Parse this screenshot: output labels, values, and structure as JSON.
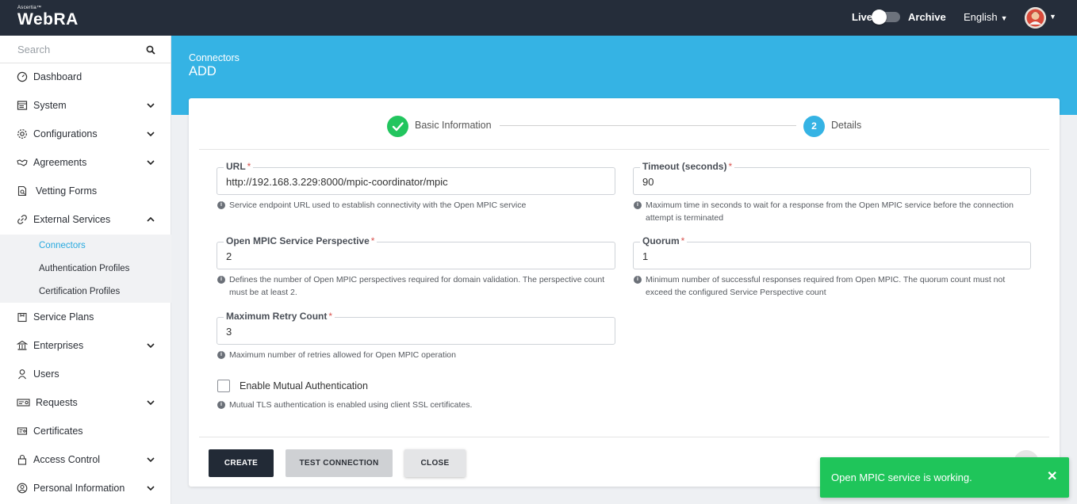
{
  "header": {
    "brand_small": "Ascertia™",
    "brand": "WebRA",
    "live_label": "Live",
    "archive_label": "Archive",
    "language": "English"
  },
  "sidebar": {
    "search_placeholder": "Search",
    "items": [
      {
        "label": "Dashboard",
        "icon": "dashboard-icon"
      },
      {
        "label": "System",
        "icon": "system-icon"
      },
      {
        "label": "Configurations",
        "icon": "gear-icon"
      },
      {
        "label": "Agreements",
        "icon": "handshake-icon"
      },
      {
        "label": "Vetting Forms",
        "icon": "document-search-icon"
      },
      {
        "label": "External Services",
        "icon": "link-icon"
      },
      {
        "label": "Service Plans",
        "icon": "package-icon"
      },
      {
        "label": "Enterprises",
        "icon": "bank-icon"
      },
      {
        "label": "Users",
        "icon": "user-icon"
      },
      {
        "label": "Requests",
        "icon": "requests-icon"
      },
      {
        "label": "Certificates",
        "icon": "certificate-icon"
      },
      {
        "label": "Access Control",
        "icon": "lock-icon"
      },
      {
        "label": "Personal Information",
        "icon": "user-circle-icon"
      }
    ],
    "sub_items": [
      "Connectors",
      "Authentication Profiles",
      "Certification Profiles"
    ]
  },
  "page": {
    "breadcrumb": "Connectors",
    "title": "ADD"
  },
  "steps": {
    "step1_label": "Basic Information",
    "step2_number": "2",
    "step2_label": "Details"
  },
  "form": {
    "url": {
      "label": "URL",
      "value": "http://192.168.3.229:8000/mpic-coordinator/mpic",
      "help": "Service endpoint URL used to establish connectivity with the Open MPIC service"
    },
    "timeout": {
      "label": "Timeout (seconds)",
      "value": "90",
      "help": "Maximum time in seconds to wait for a response from the Open MPIC service before the connection attempt is terminated"
    },
    "perspective": {
      "label": "Open MPIC Service Perspective",
      "value": "2",
      "help": "Defines the number of Open MPIC perspectives required for domain validation. The perspective count must be at least 2."
    },
    "quorum": {
      "label": "Quorum",
      "value": "1",
      "help": "Minimum number of successful responses required from Open MPIC. The quorum count must not exceed the configured Service Perspective count"
    },
    "retry": {
      "label": "Maximum Retry Count",
      "value": "3",
      "help": "Maximum number of retries allowed for Open MPIC operation"
    },
    "mutual_auth": {
      "label": "Enable Mutual Authentication",
      "checked": false,
      "help": "Mutual TLS authentication is enabled using client SSL certificates."
    },
    "required_mark": "*",
    "info_glyph": "i"
  },
  "buttons": {
    "create": "CREATE",
    "test": "TEST CONNECTION",
    "close": "CLOSE"
  },
  "toast": {
    "message": "Open MPIC service is working.",
    "close_glyph": "✕",
    "color": "#1fc55a"
  },
  "colors": {
    "topbar": "#252d3a",
    "accent": "#35b3e4",
    "success": "#22c55e"
  }
}
